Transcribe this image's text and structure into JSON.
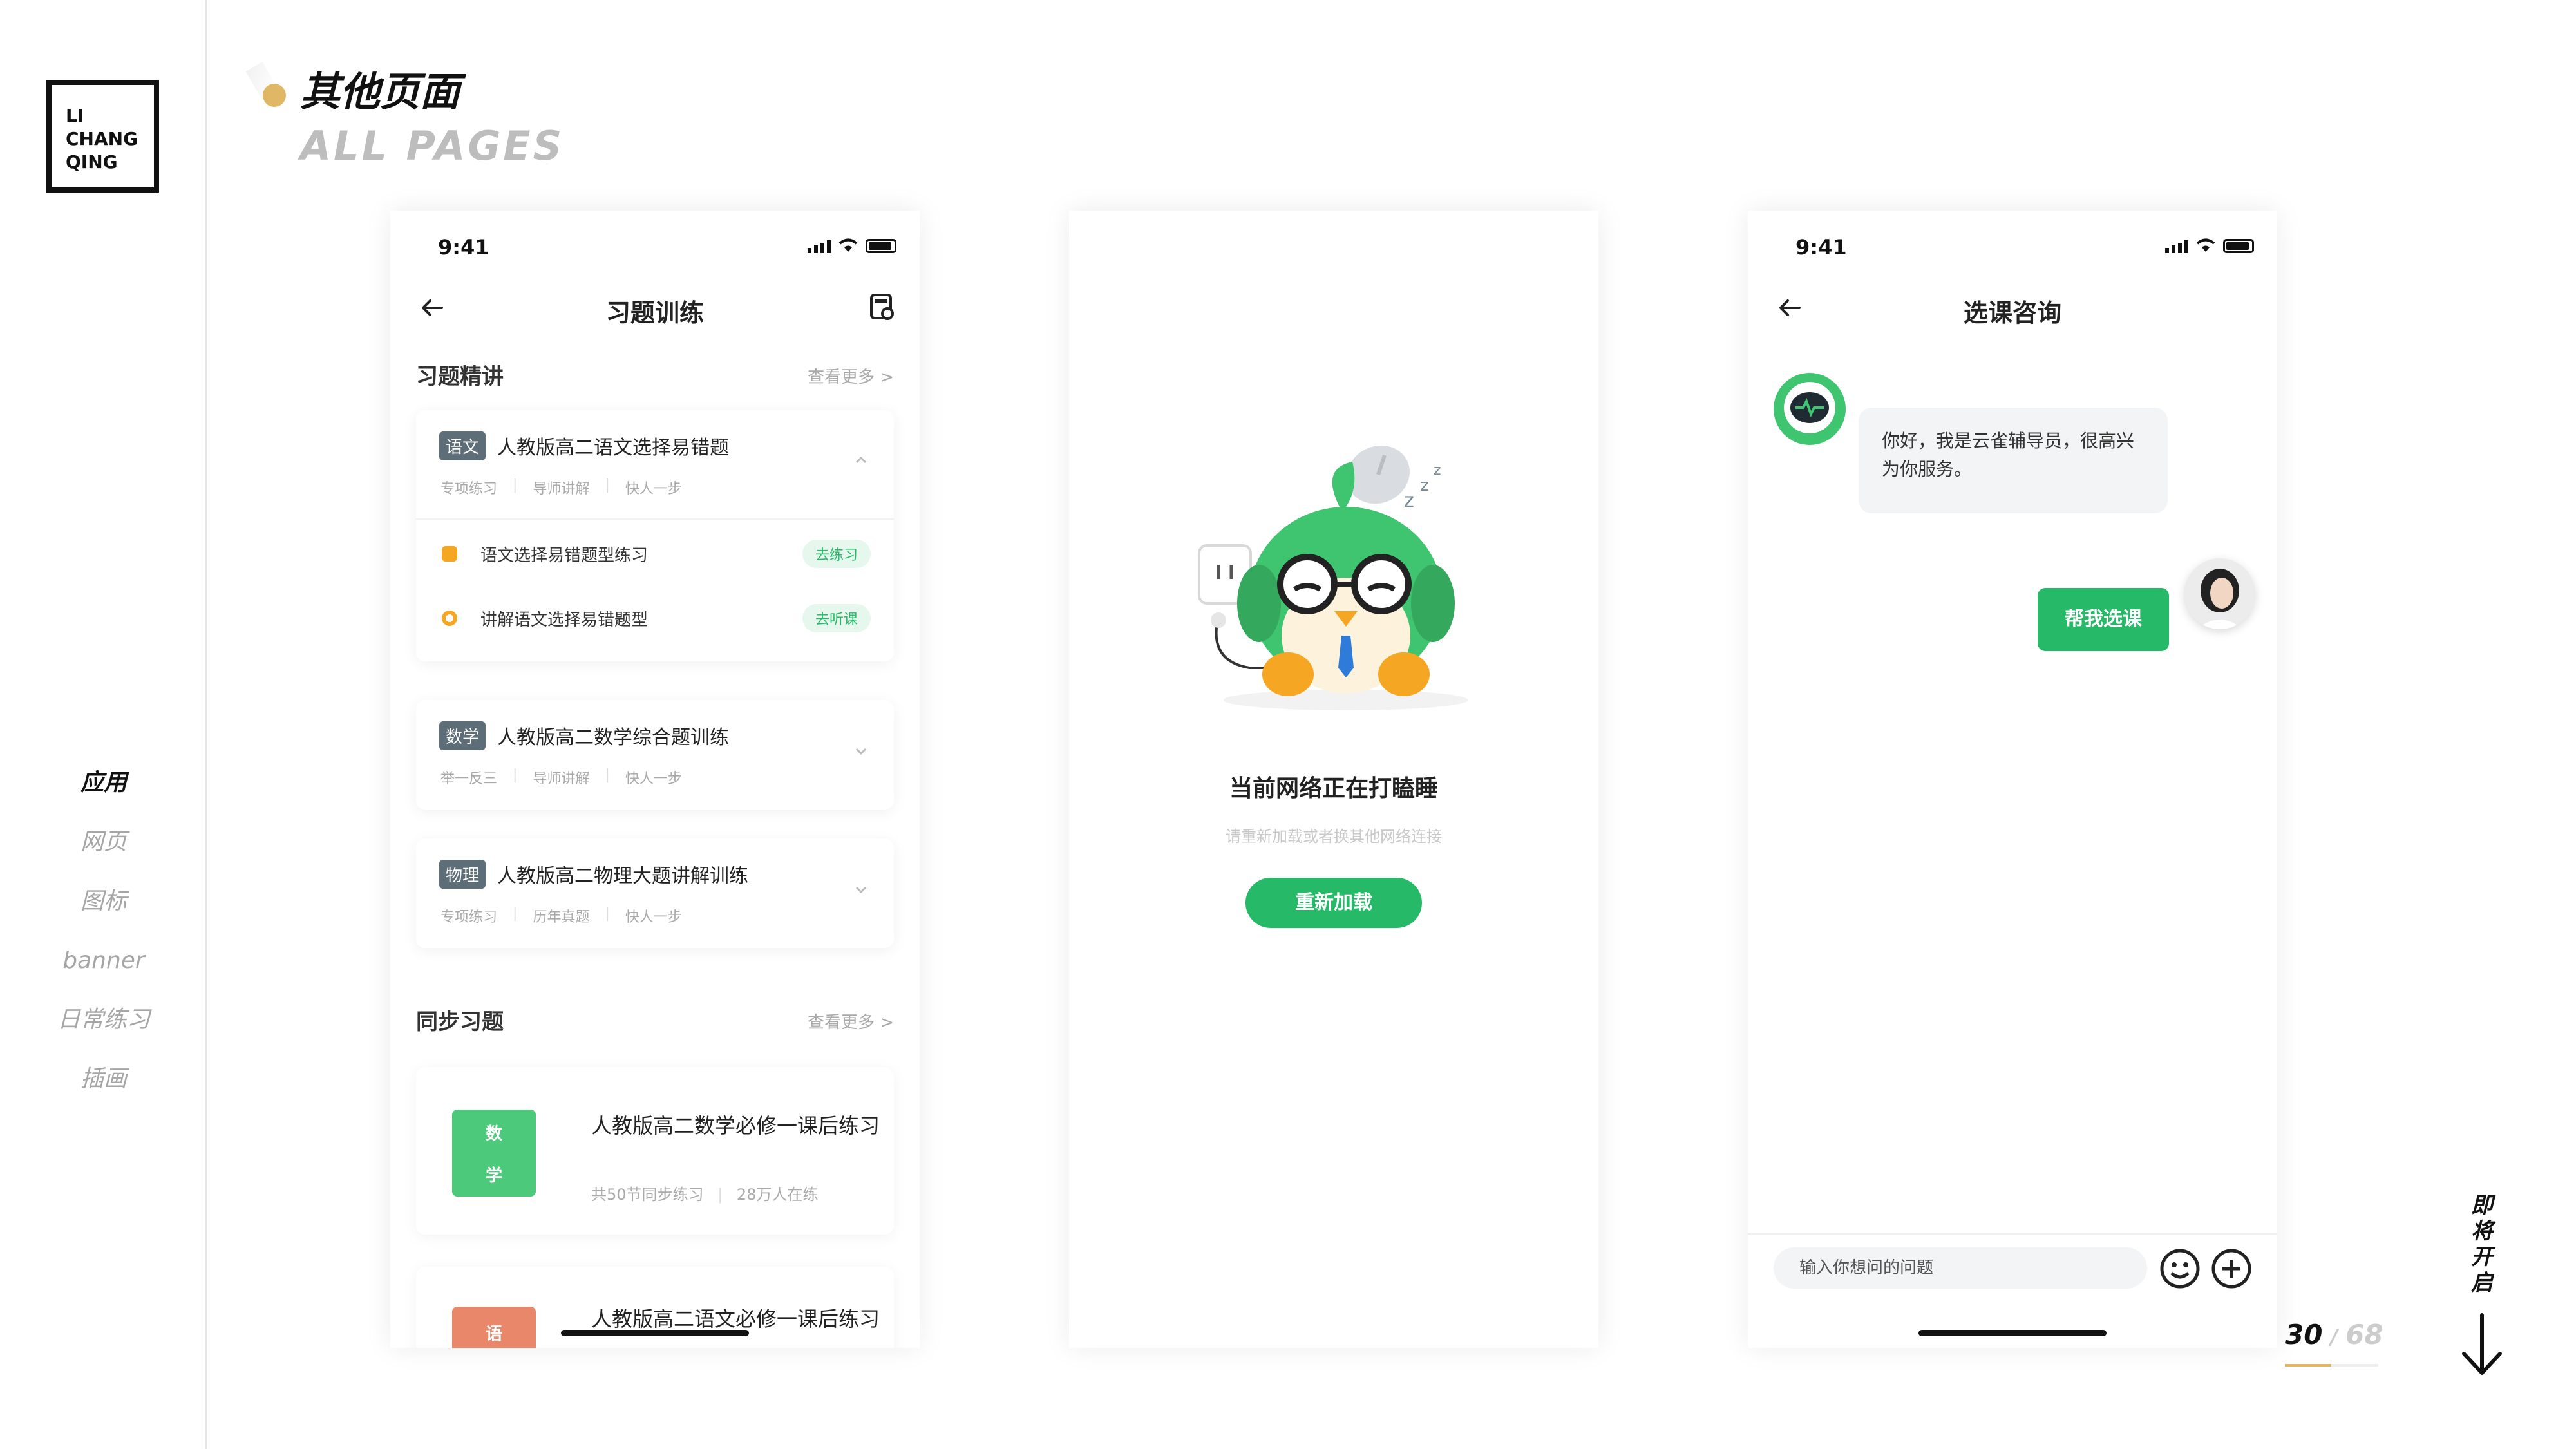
{
  "logo": {
    "lines": [
      "LI",
      "CHANG",
      "QING"
    ]
  },
  "header": {
    "title_cn": "其他页面",
    "title_en": "ALL PAGES"
  },
  "sidebar": {
    "items": [
      {
        "label": "应用",
        "active": true
      },
      {
        "label": "网页",
        "active": false
      },
      {
        "label": "图标",
        "active": false
      },
      {
        "label": "banner",
        "active": false
      },
      {
        "label": "日常练习",
        "active": false
      },
      {
        "label": "插画",
        "active": false
      }
    ]
  },
  "colors": {
    "accent": "#26b968",
    "gold": "#e0b765",
    "tag": "#5e6e78"
  },
  "phone1": {
    "time": "9:41",
    "title": "习题训练",
    "section1": {
      "title": "习题精讲",
      "more": "查看更多 >"
    },
    "cards": [
      {
        "tag": "语文",
        "title": "人教版高二语文选择易错题",
        "meta": [
          "专项练习",
          "导师讲解",
          "快人一步"
        ],
        "expanded": true,
        "rows": [
          {
            "label": "语文选择易错题型练习",
            "button": "去练习",
            "icon_color": "#f5a623"
          },
          {
            "label": "讲解语文选择易错题型",
            "button": "去听课",
            "icon_color": "#f5a623"
          }
        ]
      },
      {
        "tag": "数学",
        "title": "人教版高二数学综合题训练",
        "meta": [
          "举一反三",
          "导师讲解",
          "快人一步"
        ]
      },
      {
        "tag": "物理",
        "title": "人教版高二物理大题讲解训练",
        "meta": [
          "专项练习",
          "历年真题",
          "快人一步"
        ]
      }
    ],
    "section2": {
      "title": "同步习题",
      "more": "查看更多 >"
    },
    "books": [
      {
        "cover": [
          "数",
          "学"
        ],
        "cover_color": "#4cc97a",
        "title": "人教版高二数学必修一课后练习",
        "meta": [
          "共50节同步练习",
          "28万人在练"
        ]
      },
      {
        "cover": [
          "语"
        ],
        "cover_color": "#e9876a",
        "title": "人教版高二语文必修一课后练习",
        "meta": []
      }
    ]
  },
  "phone2": {
    "error_title": "当前网络正在打瞌睡",
    "error_subtitle": "请重新加载或者换其他网络连接",
    "reload": "重新加载"
  },
  "phone3": {
    "time": "9:41",
    "title": "选课咨询",
    "bot_message": "你好，我是云雀辅导员，很高兴为你服务。",
    "user_message": "帮我选课",
    "input_placeholder": "输入你想问的问题"
  },
  "pager": {
    "current": "30",
    "total": "68",
    "progress": 0.5
  },
  "coming_soon": [
    "即",
    "将",
    "开",
    "启"
  ]
}
